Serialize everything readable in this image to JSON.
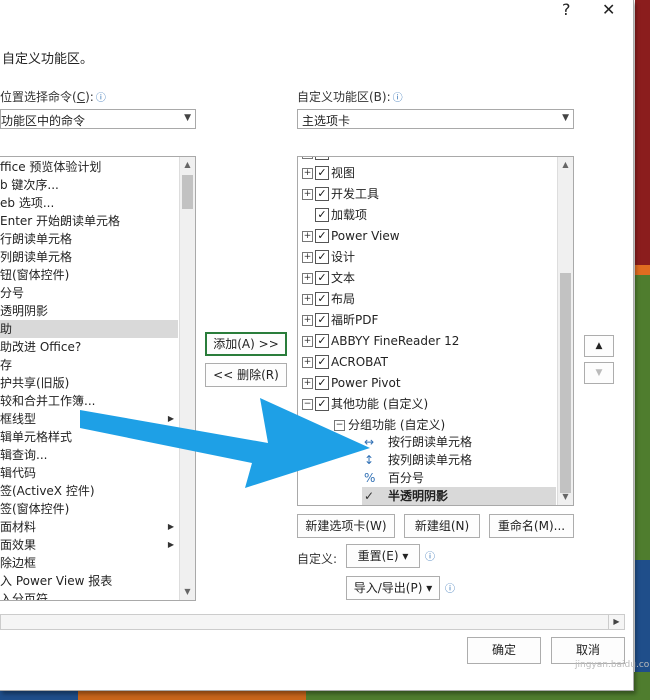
{
  "dialog": {
    "help_symbol": "?",
    "close_symbol": "✕",
    "section_title": "自定义功能区。"
  },
  "left": {
    "label": "位置选择命令(",
    "label_key": "C",
    "label_tail": "):",
    "info_icon": "ⓘ",
    "combo_value": "功能区中的命令",
    "items": [
      {
        "text": "ffice 预览体验计划",
        "submenu": false,
        "selected": false
      },
      {
        "text": "b 键次序...",
        "submenu": false,
        "selected": false
      },
      {
        "text": "eb 选项...",
        "submenu": false,
        "selected": false
      },
      {
        "text": " Enter 开始朗读单元格",
        "submenu": false,
        "selected": false
      },
      {
        "text": "行朗读单元格",
        "submenu": false,
        "selected": false
      },
      {
        "text": "列朗读单元格",
        "submenu": false,
        "selected": false
      },
      {
        "text": "钮(窗体控件)",
        "submenu": false,
        "selected": false
      },
      {
        "text": "分号",
        "submenu": false,
        "selected": false
      },
      {
        "text": "透明阴影",
        "submenu": false,
        "selected": false
      },
      {
        "text": "助",
        "submenu": false,
        "selected": true
      },
      {
        "text": "助改进 Office?",
        "submenu": false,
        "selected": false
      },
      {
        "text": "存",
        "submenu": false,
        "selected": false
      },
      {
        "text": "护共享(旧版)",
        "submenu": false,
        "selected": false
      },
      {
        "text": "较和合并工作簿...",
        "submenu": false,
        "selected": false
      },
      {
        "text": "框线型",
        "submenu": true,
        "selected": false
      },
      {
        "text": "辑单元格样式",
        "submenu": false,
        "selected": false
      },
      {
        "text": "辑查询...",
        "submenu": false,
        "selected": false
      },
      {
        "text": "辑代码",
        "submenu": false,
        "selected": false
      },
      {
        "text": "签(ActiveX 控件)",
        "submenu": false,
        "selected": false
      },
      {
        "text": "签(窗体控件)",
        "submenu": false,
        "selected": false
      },
      {
        "text": "面材料",
        "submenu": true,
        "selected": false
      },
      {
        "text": "面效果",
        "submenu": true,
        "selected": false
      },
      {
        "text": "除边框",
        "submenu": false,
        "selected": false
      },
      {
        "text": "入 Power View 报表",
        "submenu": false,
        "selected": false
      },
      {
        "text": "入分页符",
        "submenu": false,
        "selected": false
      }
    ]
  },
  "middle": {
    "add_button": "添加(A) >>",
    "remove_button": "<< 删除(R)"
  },
  "right": {
    "label": "自定义功能区(B):",
    "info_icon": "ⓘ",
    "combo_value": "主选项卡",
    "tree": [
      {
        "text": "视图",
        "level": 0,
        "pm": "+",
        "checked": true
      },
      {
        "text": "开发工具",
        "level": 0,
        "pm": "+",
        "checked": true
      },
      {
        "text": "加载项",
        "level": 0,
        "pm": "",
        "checked": true
      },
      {
        "text": "Power View",
        "level": 0,
        "pm": "+",
        "checked": true
      },
      {
        "text": "设计",
        "level": 0,
        "pm": "+",
        "checked": true
      },
      {
        "text": "文本",
        "level": 0,
        "pm": "+",
        "checked": true
      },
      {
        "text": "布局",
        "level": 0,
        "pm": "+",
        "checked": true
      },
      {
        "text": "福昕PDF",
        "level": 0,
        "pm": "+",
        "checked": true
      },
      {
        "text": "ABBYY FineReader 12",
        "level": 0,
        "pm": "+",
        "checked": true
      },
      {
        "text": "ACROBAT",
        "level": 0,
        "pm": "+",
        "checked": true
      },
      {
        "text": "Power Pivot",
        "level": 0,
        "pm": "+",
        "checked": true
      },
      {
        "text": "其他功能 (自定义)",
        "level": 0,
        "pm": "−",
        "checked": true
      }
    ],
    "group": {
      "text": "分组功能 (自定义)",
      "pm": "−"
    },
    "commands": [
      {
        "icon": "↔",
        "text": "按行朗读单元格",
        "selected": false
      },
      {
        "icon": "↕",
        "text": "按列朗读单元格",
        "selected": false
      },
      {
        "icon": "%",
        "text": "百分号",
        "selected": false
      },
      {
        "icon": "✓",
        "text": "半透明阴影",
        "selected": true
      }
    ],
    "new_tab_button": "新建选项卡(W)",
    "new_group_button": "新建组(N)",
    "rename_button": "重命名(M)...",
    "customize_label": "自定义:",
    "reset_button": "重置(E) ▾",
    "import_export_button": "导入/导出(P) ▾"
  },
  "side": {
    "up": "▲",
    "down": "▼"
  },
  "footer": {
    "ok_button": "确定",
    "cancel_button": "取消"
  },
  "colors": {
    "accent": "#2a7d3b",
    "arrow": "#1ea0e6",
    "selection": "#d9d9d9"
  },
  "watermark": "jingyan.baidu.com"
}
